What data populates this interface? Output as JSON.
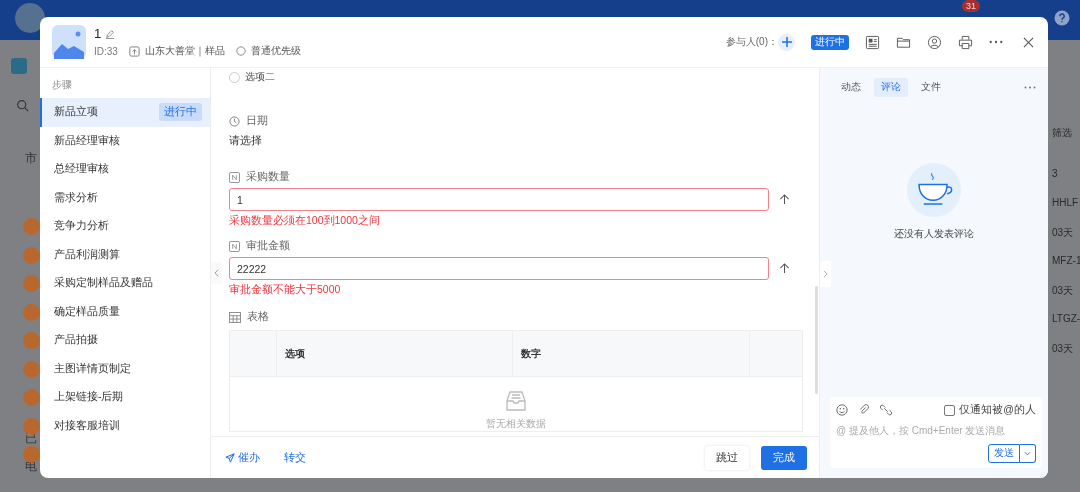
{
  "background": {
    "badge": "31",
    "left_texts": [
      "市",
      "已",
      "电"
    ],
    "right_texts": [
      "筛选",
      "3",
      "HHLF",
      "03天",
      "MFZ-1",
      "03天",
      "LTGZ-",
      "03天"
    ]
  },
  "header": {
    "title": "1",
    "id": "ID:33",
    "project": "山东大善堂｜样品",
    "priority": "普通优先级",
    "participants_label": "参与人(0)：",
    "status": "进行中"
  },
  "steps": {
    "heading": "步骤",
    "items": [
      {
        "label": "新品立项",
        "selected": true,
        "badge": "进行中"
      },
      {
        "label": "新品经理审核",
        "selected": false
      },
      {
        "label": "总经理审核",
        "selected": false
      },
      {
        "label": "需求分析",
        "selected": false
      },
      {
        "label": "竞争力分析",
        "selected": false
      },
      {
        "label": "产品利润测算",
        "selected": false
      },
      {
        "label": "采购定制样品及赠品",
        "selected": false
      },
      {
        "label": "确定样品质量",
        "selected": false
      },
      {
        "label": "产品拍摄",
        "selected": false
      },
      {
        "label": "主图详情页制定",
        "selected": false
      },
      {
        "label": "上架链接-后期",
        "selected": false
      },
      {
        "label": "对接客服培训",
        "selected": false
      }
    ]
  },
  "form": {
    "fields": [
      {
        "kind": "radio",
        "label": "选项二",
        "checked": false
      },
      {
        "kind": "date",
        "label": "日期",
        "placeholder": "请选择"
      },
      {
        "kind": "number",
        "label": "采购数量",
        "value": "1",
        "error": "采购数量必须在100到1000之间"
      },
      {
        "kind": "number",
        "label": "审批金额",
        "value": "22222",
        "error": "审批金额不能大于5000"
      },
      {
        "kind": "table",
        "label": "表格",
        "columns": [
          "选项",
          "数字"
        ],
        "empty_text": "暂无相关数据"
      }
    ]
  },
  "footer": {
    "urge": "催办",
    "transfer": "转交",
    "skip": "跳过",
    "complete": "完成"
  },
  "comments": {
    "tabs": [
      {
        "label": "动态",
        "selected": false
      },
      {
        "label": "评论",
        "selected": true
      },
      {
        "label": "文件",
        "selected": false
      }
    ],
    "empty_text": "还没有人发表评论",
    "notify": {
      "label": "仅通知被@的人",
      "checked": false
    },
    "placeholder": "@ 提及他人，按 Cmd+Enter 发送消息",
    "send": "发送"
  }
}
